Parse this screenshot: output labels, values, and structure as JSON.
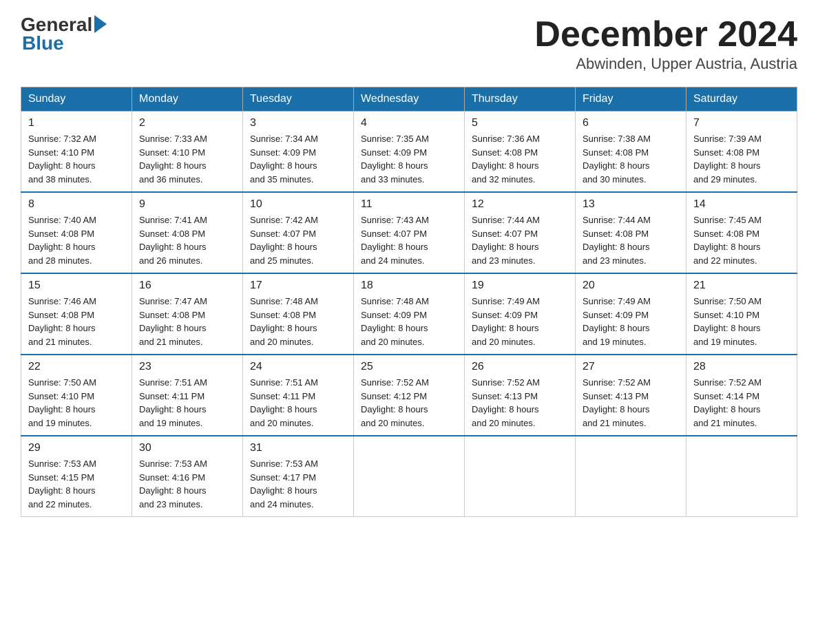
{
  "logo": {
    "general": "General",
    "blue": "Blue"
  },
  "header": {
    "month": "December 2024",
    "location": "Abwinden, Upper Austria, Austria"
  },
  "days_of_week": [
    "Sunday",
    "Monday",
    "Tuesday",
    "Wednesday",
    "Thursday",
    "Friday",
    "Saturday"
  ],
  "weeks": [
    [
      {
        "day": "1",
        "sunrise": "7:32 AM",
        "sunset": "4:10 PM",
        "daylight": "8 hours and 38 minutes."
      },
      {
        "day": "2",
        "sunrise": "7:33 AM",
        "sunset": "4:10 PM",
        "daylight": "8 hours and 36 minutes."
      },
      {
        "day": "3",
        "sunrise": "7:34 AM",
        "sunset": "4:09 PM",
        "daylight": "8 hours and 35 minutes."
      },
      {
        "day": "4",
        "sunrise": "7:35 AM",
        "sunset": "4:09 PM",
        "daylight": "8 hours and 33 minutes."
      },
      {
        "day": "5",
        "sunrise": "7:36 AM",
        "sunset": "4:08 PM",
        "daylight": "8 hours and 32 minutes."
      },
      {
        "day": "6",
        "sunrise": "7:38 AM",
        "sunset": "4:08 PM",
        "daylight": "8 hours and 30 minutes."
      },
      {
        "day": "7",
        "sunrise": "7:39 AM",
        "sunset": "4:08 PM",
        "daylight": "8 hours and 29 minutes."
      }
    ],
    [
      {
        "day": "8",
        "sunrise": "7:40 AM",
        "sunset": "4:08 PM",
        "daylight": "8 hours and 28 minutes."
      },
      {
        "day": "9",
        "sunrise": "7:41 AM",
        "sunset": "4:08 PM",
        "daylight": "8 hours and 26 minutes."
      },
      {
        "day": "10",
        "sunrise": "7:42 AM",
        "sunset": "4:07 PM",
        "daylight": "8 hours and 25 minutes."
      },
      {
        "day": "11",
        "sunrise": "7:43 AM",
        "sunset": "4:07 PM",
        "daylight": "8 hours and 24 minutes."
      },
      {
        "day": "12",
        "sunrise": "7:44 AM",
        "sunset": "4:07 PM",
        "daylight": "8 hours and 23 minutes."
      },
      {
        "day": "13",
        "sunrise": "7:44 AM",
        "sunset": "4:08 PM",
        "daylight": "8 hours and 23 minutes."
      },
      {
        "day": "14",
        "sunrise": "7:45 AM",
        "sunset": "4:08 PM",
        "daylight": "8 hours and 22 minutes."
      }
    ],
    [
      {
        "day": "15",
        "sunrise": "7:46 AM",
        "sunset": "4:08 PM",
        "daylight": "8 hours and 21 minutes."
      },
      {
        "day": "16",
        "sunrise": "7:47 AM",
        "sunset": "4:08 PM",
        "daylight": "8 hours and 21 minutes."
      },
      {
        "day": "17",
        "sunrise": "7:48 AM",
        "sunset": "4:08 PM",
        "daylight": "8 hours and 20 minutes."
      },
      {
        "day": "18",
        "sunrise": "7:48 AM",
        "sunset": "4:09 PM",
        "daylight": "8 hours and 20 minutes."
      },
      {
        "day": "19",
        "sunrise": "7:49 AM",
        "sunset": "4:09 PM",
        "daylight": "8 hours and 20 minutes."
      },
      {
        "day": "20",
        "sunrise": "7:49 AM",
        "sunset": "4:09 PM",
        "daylight": "8 hours and 19 minutes."
      },
      {
        "day": "21",
        "sunrise": "7:50 AM",
        "sunset": "4:10 PM",
        "daylight": "8 hours and 19 minutes."
      }
    ],
    [
      {
        "day": "22",
        "sunrise": "7:50 AM",
        "sunset": "4:10 PM",
        "daylight": "8 hours and 19 minutes."
      },
      {
        "day": "23",
        "sunrise": "7:51 AM",
        "sunset": "4:11 PM",
        "daylight": "8 hours and 19 minutes."
      },
      {
        "day": "24",
        "sunrise": "7:51 AM",
        "sunset": "4:11 PM",
        "daylight": "8 hours and 20 minutes."
      },
      {
        "day": "25",
        "sunrise": "7:52 AM",
        "sunset": "4:12 PM",
        "daylight": "8 hours and 20 minutes."
      },
      {
        "day": "26",
        "sunrise": "7:52 AM",
        "sunset": "4:13 PM",
        "daylight": "8 hours and 20 minutes."
      },
      {
        "day": "27",
        "sunrise": "7:52 AM",
        "sunset": "4:13 PM",
        "daylight": "8 hours and 21 minutes."
      },
      {
        "day": "28",
        "sunrise": "7:52 AM",
        "sunset": "4:14 PM",
        "daylight": "8 hours and 21 minutes."
      }
    ],
    [
      {
        "day": "29",
        "sunrise": "7:53 AM",
        "sunset": "4:15 PM",
        "daylight": "8 hours and 22 minutes."
      },
      {
        "day": "30",
        "sunrise": "7:53 AM",
        "sunset": "4:16 PM",
        "daylight": "8 hours and 23 minutes."
      },
      {
        "day": "31",
        "sunrise": "7:53 AM",
        "sunset": "4:17 PM",
        "daylight": "8 hours and 24 minutes."
      },
      null,
      null,
      null,
      null
    ]
  ]
}
